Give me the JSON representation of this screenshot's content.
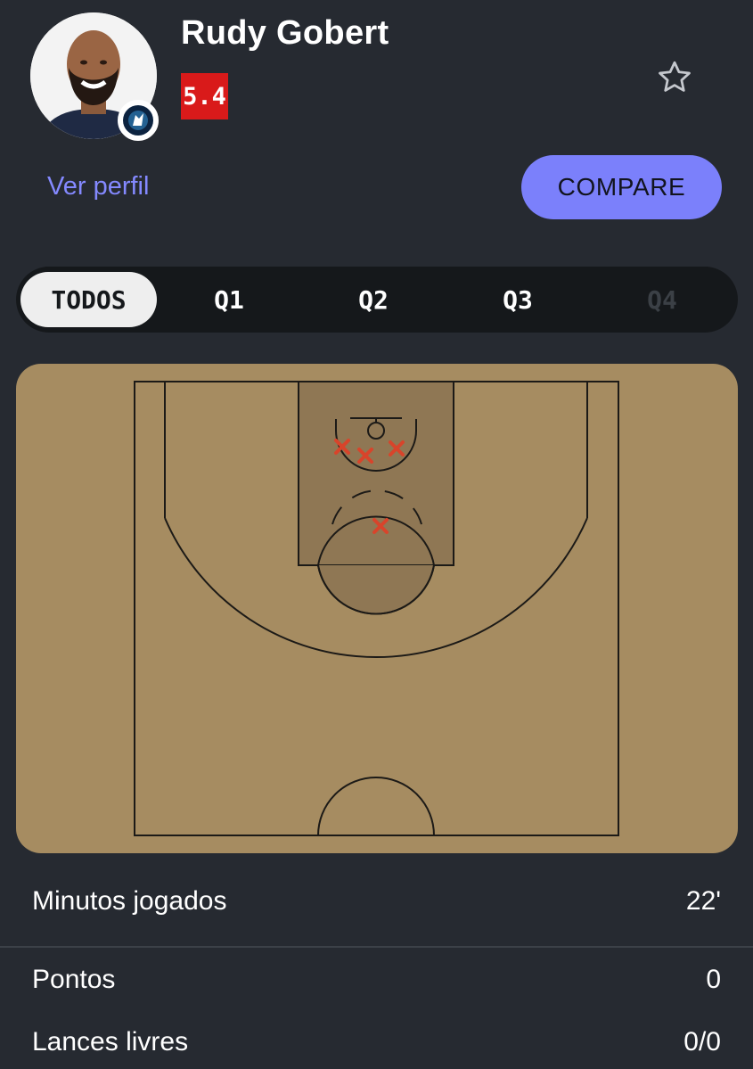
{
  "player": {
    "name": "Rudy Gobert",
    "rating": "5.4",
    "favorite_icon": "star-outline-icon"
  },
  "actions": {
    "profile_link": "Ver perfil",
    "compare_label": "COMPARE"
  },
  "colors": {
    "background": "#262a31",
    "accent": "#7b80fb",
    "rating_badge": "#d91a1a",
    "court": "#a68c61",
    "paint": "#8f7754",
    "missed_shot": "#d8442b"
  },
  "tabs": [
    {
      "label": "TODOS",
      "active": true,
      "enabled": true
    },
    {
      "label": "Q1",
      "active": false,
      "enabled": true
    },
    {
      "label": "Q2",
      "active": false,
      "enabled": true
    },
    {
      "label": "Q3",
      "active": false,
      "enabled": true
    },
    {
      "label": "Q4",
      "active": false,
      "enabled": false
    }
  ],
  "shot_chart": {
    "made": 0,
    "missed": 4,
    "shots": [
      {
        "result": "missed"
      },
      {
        "result": "missed"
      },
      {
        "result": "missed"
      },
      {
        "result": "missed"
      }
    ]
  },
  "stats": [
    {
      "label": "Minutos jogados",
      "value": "22'"
    },
    {
      "label": "Pontos",
      "value": "0"
    },
    {
      "label": "Lances livres",
      "value": "0/0"
    }
  ]
}
